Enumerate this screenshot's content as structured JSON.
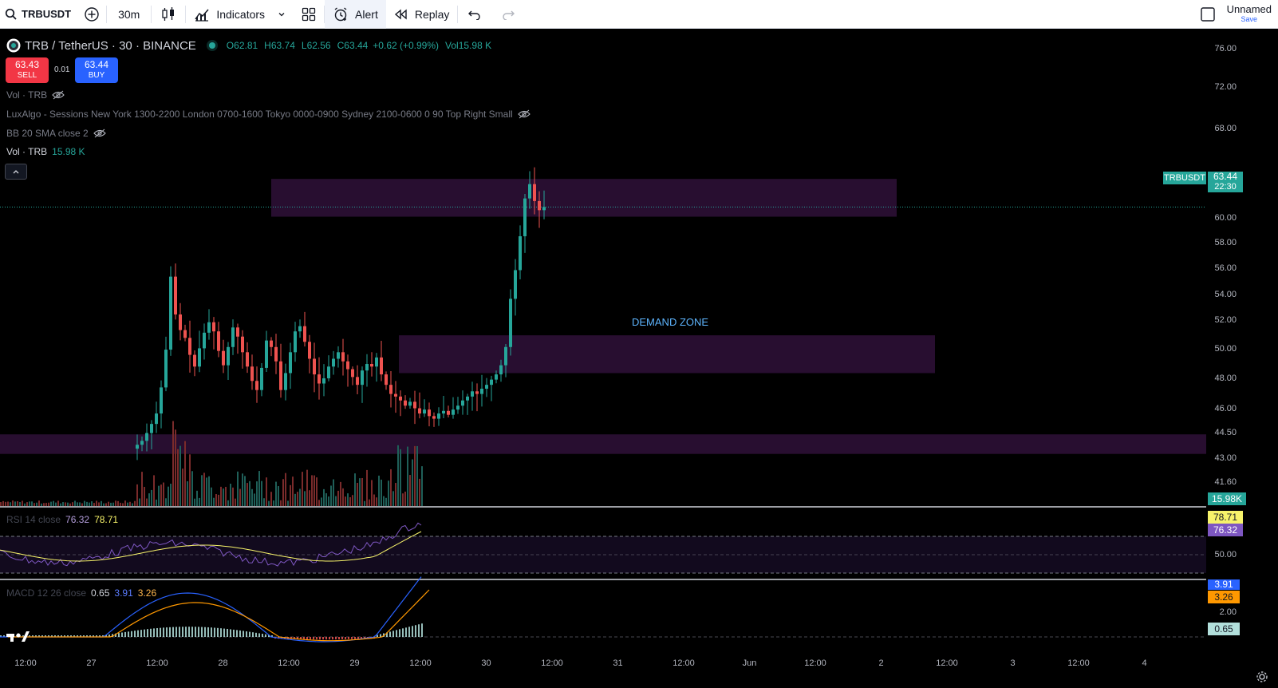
{
  "toolbar": {
    "symbol": "TRBUSDT",
    "interval": "30m",
    "indicators_label": "Indicators",
    "alert_label": "Alert",
    "replay_label": "Replay",
    "layout_name": "Unnamed",
    "save_label": "Save"
  },
  "legend": {
    "pair": "TRB / TetherUS · 30 · BINANCE",
    "open_key": "O",
    "open": "62.81",
    "high_key": "H",
    "high": "63.74",
    "low_key": "L",
    "low": "62.56",
    "close_key": "C",
    "close": "63.44",
    "change": "+0.62 (+0.99%)",
    "vol_key": "Vol",
    "vol": "15.98 K"
  },
  "trade": {
    "sell_price": "63.43",
    "sell_label": "SELL",
    "spread": "0.01",
    "buy_price": "63.44",
    "buy_label": "BUY"
  },
  "indicators": {
    "vol1": "Vol · TRB",
    "luxalgo": "LuxAlgo - Sessions New York 1300-2200 London 0700-1600 Tokyo 0000-0900 Sydney 2100-0600 0 90 Top Right Small",
    "bb": "BB 20 SMA close 2",
    "vol2": "Vol · TRB",
    "vol2_value": "15.98 K",
    "rsi": "RSI 14 close",
    "rsi_v1": "76.32",
    "rsi_v2": "78.71",
    "macd": "MACD 12 26 close",
    "macd_v1": "0.65",
    "macd_v2": "3.91",
    "macd_v3": "3.26"
  },
  "price_axis": {
    "ticks": [
      "76.00",
      "72.00",
      "68.00",
      "60.00",
      "58.00",
      "56.00",
      "54.00",
      "52.00",
      "50.00",
      "48.00",
      "46.00",
      "44.50",
      "43.00",
      "41.60"
    ],
    "current_symbol": "TRBUSDT",
    "current_price": "63.44",
    "countdown": "22:30",
    "volume_tag": "15.98K",
    "rsi_tags": [
      "78.71",
      "76.32"
    ],
    "rsi_tick": "50.00",
    "macd_tags": [
      "3.91",
      "3.26",
      "0.65"
    ],
    "macd_tick": "2.00"
  },
  "time_axis": {
    "labels": [
      "12:00",
      "27",
      "12:00",
      "28",
      "12:00",
      "29",
      "12:00",
      "30",
      "12:00",
      "31",
      "12:00",
      "Jun",
      "12:00",
      "2",
      "12:00",
      "3",
      "12:00",
      "4"
    ]
  },
  "annotations": {
    "demand_zone": "DEMAND ZONE"
  },
  "colors": {
    "up": "#26a69a",
    "down": "#ef5350",
    "zone": "#2a0f33",
    "rsi_line": "#7e57c2",
    "rsi_ma": "#f7f36a",
    "macd_line": "#2962ff",
    "signal_line": "#ff9800",
    "sell": "#f23645",
    "buy": "#2962ff"
  },
  "chart_data": {
    "type": "candlestick",
    "symbol": "TRB / TetherUS",
    "interval": "30",
    "exchange": "BINANCE",
    "ylim": [
      40.5,
      77
    ],
    "last": {
      "open": 62.81,
      "high": 63.74,
      "low": 62.56,
      "close": 63.44,
      "volume": "15.98K"
    },
    "zones": [
      {
        "label": "",
        "from_price": 62.7,
        "to_price": 65.6
      },
      {
        "label": "DEMAND ZONE",
        "from_price": 50.7,
        "to_price": 53.6
      },
      {
        "label": "",
        "from_price": 44.5,
        "to_price": 46.0
      }
    ],
    "closes": [
      45.2,
      45.5,
      46.1,
      46.8,
      47.6,
      49.6,
      52.5,
      58.1,
      55.2,
      54.0,
      53.4,
      52.1,
      51.2,
      52.6,
      53.8,
      54.6,
      53.9,
      52.4,
      51.3,
      52.7,
      54.2,
      53.5,
      52.3,
      51.2,
      50.1,
      49.4,
      51.1,
      53.2,
      52.7,
      51.6,
      49.4,
      50.7,
      52.3,
      53.9,
      54.3,
      53.1,
      51.8,
      50.6,
      49.9,
      50.3,
      51.2,
      51.8,
      52.3,
      51.6,
      51.0,
      50.4,
      49.8,
      50.9,
      51.4,
      51.2,
      51.9,
      50.6,
      49.8,
      49.1,
      48.9,
      48.6,
      48.2,
      48.5,
      48.0,
      47.6,
      47.9,
      47.4,
      47.2,
      47.6,
      47.8,
      47.5,
      47.9,
      48.2,
      48.6,
      48.9,
      49.3,
      49.1,
      49.5,
      49.8,
      50.2,
      50.6,
      51.3,
      52.7,
      56.4,
      58.6,
      61.2,
      64.1,
      65.2,
      63.9,
      63.2,
      63.44
    ]
  }
}
